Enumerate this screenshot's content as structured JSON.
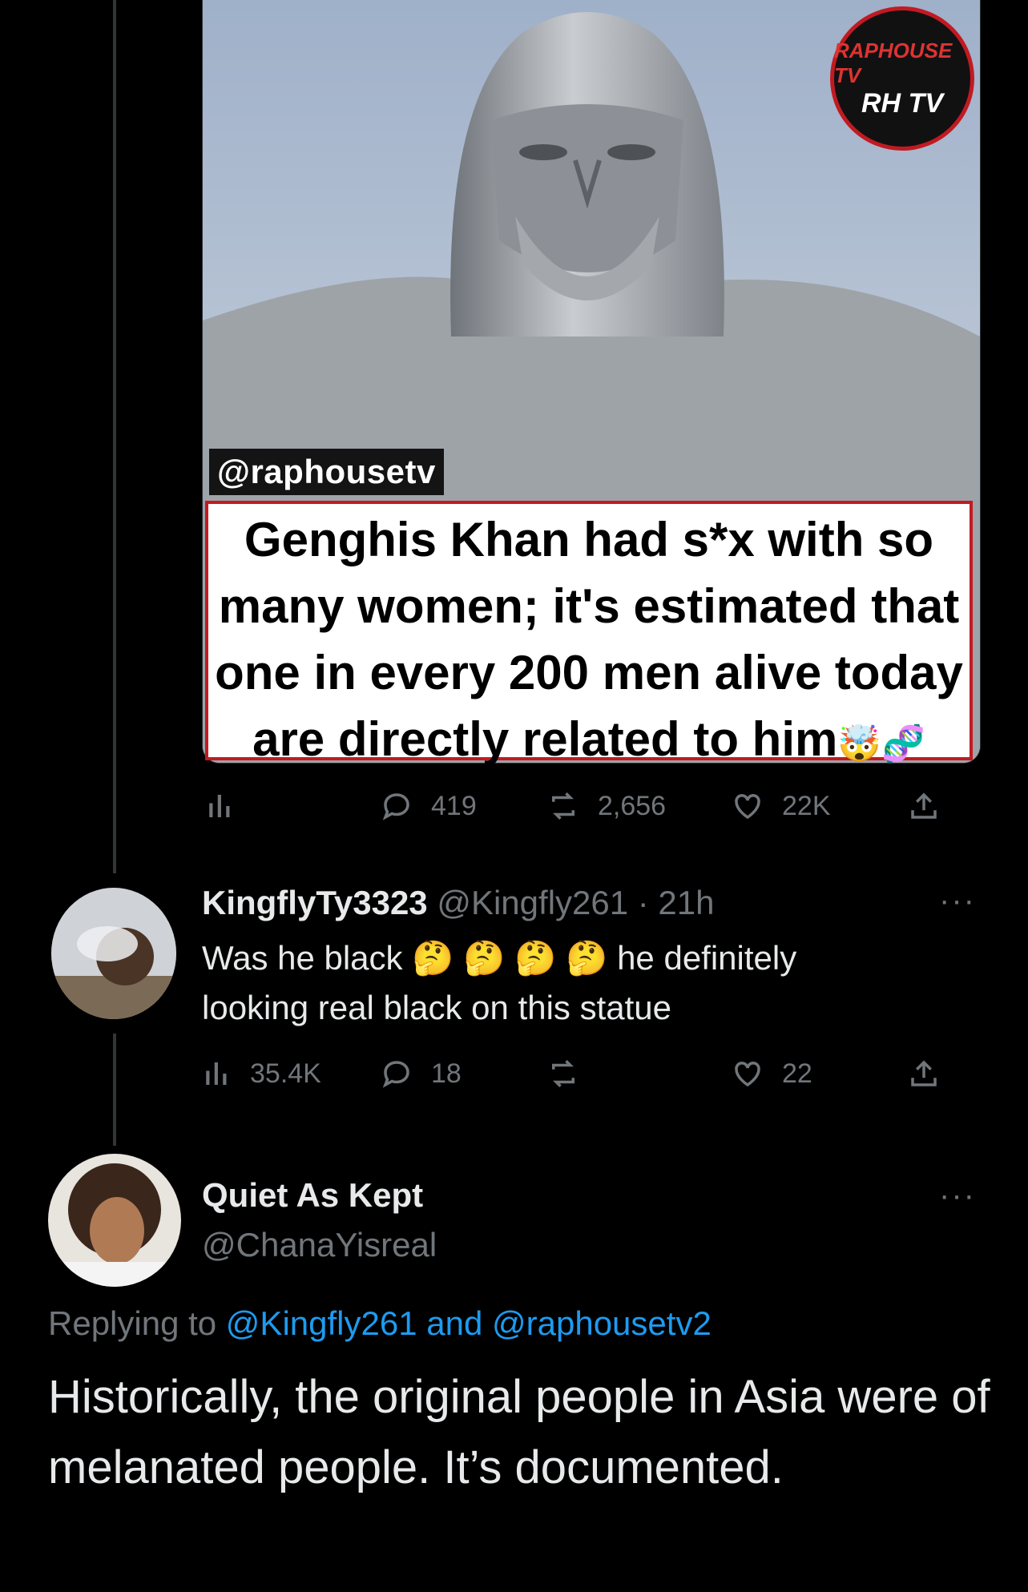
{
  "quoted_media": {
    "handle": "@raphousetv",
    "caption_lines": [
      "Genghis Khan had s*x with so",
      "many women; it's estimated that",
      "one in every 200 men alive today",
      "are directly related to him"
    ],
    "caption_emoji": "🤯🧬",
    "watermark_top": "RAPHOUSE TV",
    "watermark_bottom": "RH TV"
  },
  "tweet1_actions": {
    "replies": "419",
    "retweets": "2,656",
    "likes": "22K"
  },
  "reply1": {
    "display_name": "KingflyTy3323",
    "handle": "@Kingfly261",
    "time": "· 21h",
    "text_line1_start": "Was he black",
    "emojis": "🤔 🤔 🤔 🤔",
    "text_line1_end": "he definitely",
    "text_line2": "looking real black on this statue",
    "views": "35.4K",
    "replies": "18",
    "retweets": "",
    "likes": "22",
    "more": "···"
  },
  "reply2": {
    "display_name": "Quiet As Kept",
    "handle": "@ChanaYisreal",
    "replying_prefix": "Replying to",
    "replying_user1": "@Kingfly261",
    "replying_and": "and",
    "replying_user2": "@raphousetv2",
    "text": "Historically, the original people in Asia were of melanated people. It’s documented.",
    "more": "···"
  },
  "colors": {
    "background": "#000000",
    "text": "#e7e9ea",
    "muted": "#71767b",
    "link": "#1d9bf0",
    "caption_border": "#c21a22"
  }
}
